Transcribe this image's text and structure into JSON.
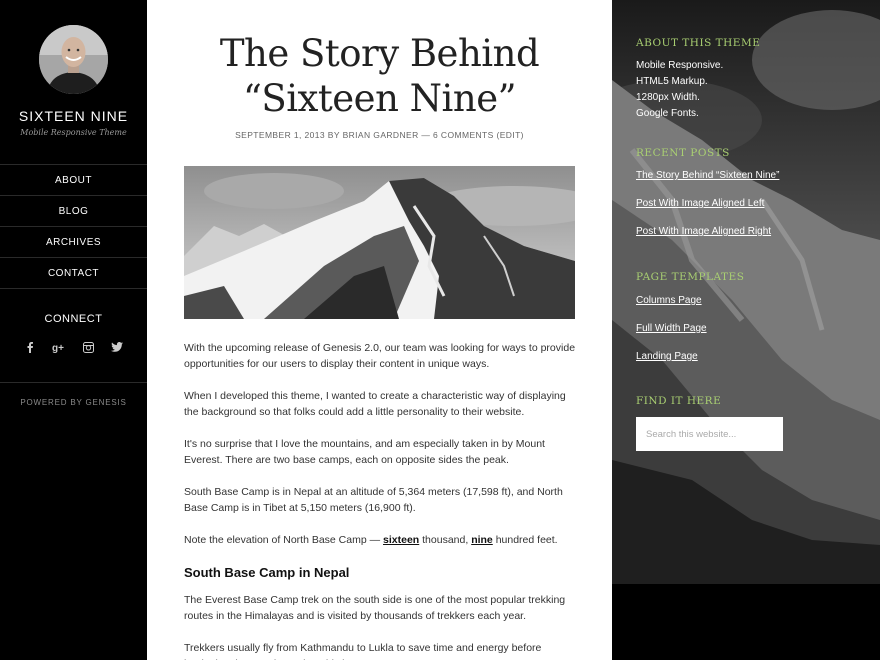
{
  "site": {
    "title": "SIXTEEN NINE",
    "description": "Mobile Responsive Theme"
  },
  "nav": {
    "items": [
      {
        "label": "ABOUT"
      },
      {
        "label": "BLOG"
      },
      {
        "label": "ARCHIVES"
      },
      {
        "label": "CONTACT"
      }
    ]
  },
  "connect": {
    "title": "CONNECT",
    "icons": [
      "facebook-icon",
      "google-plus-icon",
      "instagram-icon",
      "twitter-icon"
    ]
  },
  "footer": {
    "powered": "POWERED BY GENESIS"
  },
  "post": {
    "title_line1": "The Story Behind",
    "title_line2": "“Sixteen Nine”",
    "meta_date": "SEPTEMBER 1, 2013",
    "meta_by": "BY",
    "meta_author": "BRIAN GARDNER",
    "meta_sep": "—",
    "meta_comments": "6 COMMENTS",
    "meta_edit": "(EDIT)",
    "p1": "With the upcoming release of Genesis 2.0, our team was looking for ways to provide opportunities for our users to display their content in unique ways.",
    "p2": "When I developed this theme, I wanted to create a characteristic way of displaying the background so that folks could add a little personality to their website.",
    "p3": "It's no surprise that I love the mountains, and am especially taken in by Mount Everest. There are two base camps, each on opposite sides the peak.",
    "p4": "South Base Camp is in Nepal at an altitude of 5,364 meters (17,598 ft), and North Base Camp is in Tibet at 5,150 meters (16,900 ft).",
    "p5_before": "Note the elevation of North Base Camp — ",
    "p5_b1": "sixteen",
    "p5_mid": " thousand, ",
    "p5_b2": "nine",
    "p5_after": " hundred feet.",
    "heading": "South Base Camp in Nepal",
    "p6": "The Everest Base Camp trek on the south side is one of the most popular trekking routes in the Himalayas and is visited by thousands of trekkers each year.",
    "p7": "Trekkers usually fly from Kathmandu to Lukla to save time and energy before beginning the morning trek to this base camp."
  },
  "sidebar": {
    "about_title": "ABOUT THIS THEME",
    "about_lines": [
      "Mobile Responsive.",
      "HTML5 Markup.",
      "1280px Width.",
      "Google Fonts."
    ],
    "recent_title": "RECENT POSTS",
    "recent_posts": [
      "The Story Behind “Sixteen Nine”",
      "Post With Image Aligned Left",
      "Post With Image Aligned Right"
    ],
    "templates_title": "PAGE TEMPLATES",
    "templates": [
      "Columns Page",
      "Full Width Page",
      "Landing Page"
    ],
    "find_title": "FIND IT HERE",
    "search_placeholder": "Search this website..."
  },
  "colors": {
    "accent": "#a9cf72",
    "sidebar_bg": "#000000",
    "content_bg": "#ffffff"
  }
}
